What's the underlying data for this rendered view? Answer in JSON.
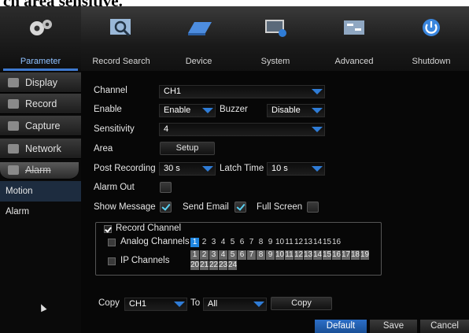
{
  "caption": "ch area sensitive.",
  "tabs": [
    {
      "label": "Parameter",
      "icon": "gears-icon"
    },
    {
      "label": "Record Search",
      "icon": "magnifier-icon"
    },
    {
      "label": "Device",
      "icon": "hdd-icon"
    },
    {
      "label": "System",
      "icon": "monitor-info-icon"
    },
    {
      "label": "Advanced",
      "icon": "advanced-icon"
    },
    {
      "label": "Shutdown",
      "icon": "power-icon"
    }
  ],
  "sidebar": {
    "items": [
      {
        "label": "Display",
        "icon": "display-icon"
      },
      {
        "label": "Record",
        "icon": "record-icon"
      },
      {
        "label": "Capture",
        "icon": "capture-icon"
      },
      {
        "label": "Network",
        "icon": "network-icon"
      },
      {
        "label": "Alarm",
        "icon": "alarm-icon"
      }
    ],
    "sub_items": [
      "Motion",
      "Alarm"
    ]
  },
  "form": {
    "channel_label": "Channel",
    "channel_value": "CH1",
    "enable_label": "Enable",
    "enable_value": "Enable",
    "buzzer_label": "Buzzer",
    "buzzer_value": "Disable",
    "sensitivity_label": "Sensitivity",
    "sensitivity_value": "4",
    "area_label": "Area",
    "setup_button": "Setup",
    "post_recording_label": "Post Recording",
    "post_recording_value": "30 s",
    "latch_time_label": "Latch Time",
    "latch_time_value": "10 s",
    "alarm_out_label": "Alarm Out",
    "show_message_label": "Show Message",
    "send_email_label": "Send Email",
    "full_screen_label": "Full Screen",
    "record_channel_label": "Record Channel",
    "analog_channels_label": "Analog Channels",
    "ip_channels_label": "IP Channels",
    "analog_channels": [
      "1",
      "2",
      "3",
      "4",
      "5",
      "6",
      "7",
      "8",
      "9",
      "10",
      "11",
      "12",
      "13",
      "14",
      "15",
      "16"
    ],
    "ip_channels": [
      "1",
      "2",
      "3",
      "4",
      "5",
      "6",
      "7",
      "8",
      "9",
      "10",
      "11",
      "12",
      "13",
      "14",
      "15",
      "16",
      "17",
      "18",
      "19",
      "20",
      "21",
      "22",
      "23",
      "24"
    ],
    "copy_label": "Copy",
    "copy_from": "CH1",
    "to_label": "To",
    "copy_to": "All",
    "copy_button": "Copy"
  },
  "footer": {
    "default": "Default",
    "save": "Save",
    "cancel": "Cancel"
  },
  "colors": {
    "accent": "#2f7cd6",
    "highlight": "#1f86e0",
    "default_button": "#1d5fb0"
  }
}
